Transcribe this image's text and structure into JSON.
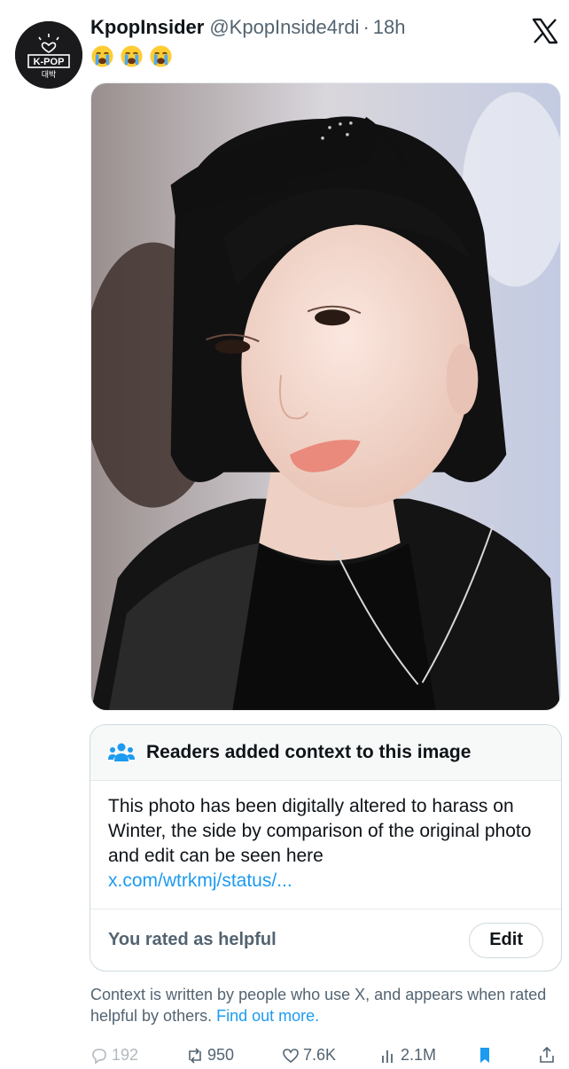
{
  "tweet": {
    "display_name": "KpopInsider",
    "handle": "@KpopInside4rdi",
    "separator": "·",
    "time": "18h",
    "emoji_icons": [
      "loudly-crying-face",
      "loudly-crying-face",
      "loudly-crying-face"
    ]
  },
  "avatar": {
    "badge_text": "K-POP",
    "korean_text": "대박"
  },
  "community_note": {
    "title": "Readers added context to this image",
    "body": "This photo has been digitally altered to harass on Winter, the side by comparison of the original photo and edit can be seen here",
    "link": "x.com/wtrkmj/status/...",
    "rated_label": "You rated as helpful",
    "edit_label": "Edit"
  },
  "disclaimer": {
    "text": "Context is written by people who use X, and appears when rated helpful by others.",
    "link": "Find out more."
  },
  "actions": {
    "replies": "192",
    "reposts": "950",
    "likes": "7.6K",
    "views": "2.1M"
  },
  "colors": {
    "accent": "#1d9bf0",
    "muted": "#536471",
    "text": "#0f1419"
  }
}
